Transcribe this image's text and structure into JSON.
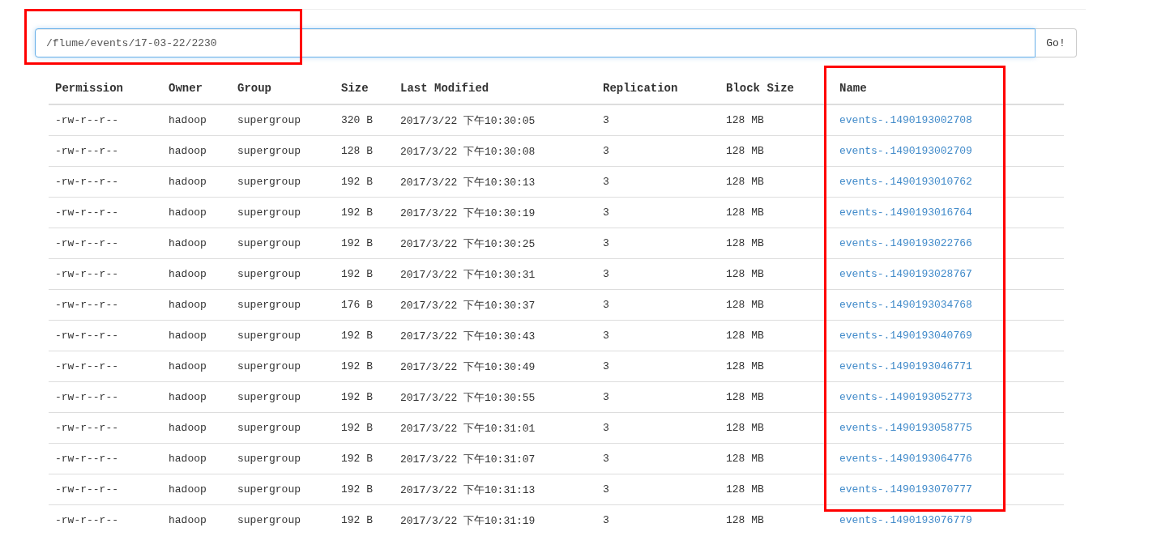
{
  "path_field": {
    "value": "/flume/events/17-03-22/2230"
  },
  "go_button": "Go!",
  "table": {
    "columns": [
      "Permission",
      "Owner",
      "Group",
      "Size",
      "Last Modified",
      "Replication",
      "Block Size",
      "Name"
    ],
    "rows": [
      [
        "-rw-r--r--",
        "hadoop",
        "supergroup",
        "320 B",
        "2017/3/22 下午10:30:05",
        "3",
        "128 MB",
        "events-.1490193002708"
      ],
      [
        "-rw-r--r--",
        "hadoop",
        "supergroup",
        "128 B",
        "2017/3/22 下午10:30:08",
        "3",
        "128 MB",
        "events-.1490193002709"
      ],
      [
        "-rw-r--r--",
        "hadoop",
        "supergroup",
        "192 B",
        "2017/3/22 下午10:30:13",
        "3",
        "128 MB",
        "events-.1490193010762"
      ],
      [
        "-rw-r--r--",
        "hadoop",
        "supergroup",
        "192 B",
        "2017/3/22 下午10:30:19",
        "3",
        "128 MB",
        "events-.1490193016764"
      ],
      [
        "-rw-r--r--",
        "hadoop",
        "supergroup",
        "192 B",
        "2017/3/22 下午10:30:25",
        "3",
        "128 MB",
        "events-.1490193022766"
      ],
      [
        "-rw-r--r--",
        "hadoop",
        "supergroup",
        "192 B",
        "2017/3/22 下午10:30:31",
        "3",
        "128 MB",
        "events-.1490193028767"
      ],
      [
        "-rw-r--r--",
        "hadoop",
        "supergroup",
        "176 B",
        "2017/3/22 下午10:30:37",
        "3",
        "128 MB",
        "events-.1490193034768"
      ],
      [
        "-rw-r--r--",
        "hadoop",
        "supergroup",
        "192 B",
        "2017/3/22 下午10:30:43",
        "3",
        "128 MB",
        "events-.1490193040769"
      ],
      [
        "-rw-r--r--",
        "hadoop",
        "supergroup",
        "192 B",
        "2017/3/22 下午10:30:49",
        "3",
        "128 MB",
        "events-.1490193046771"
      ],
      [
        "-rw-r--r--",
        "hadoop",
        "supergroup",
        "192 B",
        "2017/3/22 下午10:30:55",
        "3",
        "128 MB",
        "events-.1490193052773"
      ],
      [
        "-rw-r--r--",
        "hadoop",
        "supergroup",
        "192 B",
        "2017/3/22 下午10:31:01",
        "3",
        "128 MB",
        "events-.1490193058775"
      ],
      [
        "-rw-r--r--",
        "hadoop",
        "supergroup",
        "192 B",
        "2017/3/22 下午10:31:07",
        "3",
        "128 MB",
        "events-.1490193064776"
      ],
      [
        "-rw-r--r--",
        "hadoop",
        "supergroup",
        "192 B",
        "2017/3/22 下午10:31:13",
        "3",
        "128 MB",
        "events-.1490193070777"
      ],
      [
        "-rw-r--r--",
        "hadoop",
        "supergroup",
        "192 B",
        "2017/3/22 下午10:31:19",
        "3",
        "128 MB",
        "events-.1490193076779"
      ]
    ]
  }
}
